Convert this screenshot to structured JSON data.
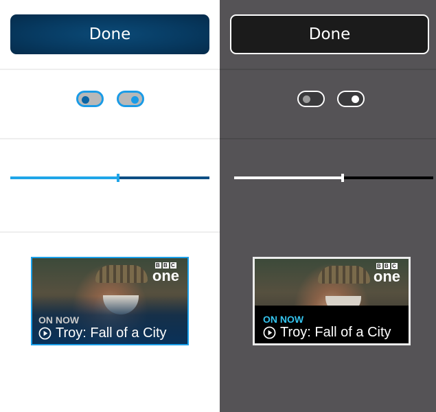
{
  "done_button": {
    "label": "Done"
  },
  "card": {
    "badge": "ON NOW",
    "title": "Troy: Fall of a City",
    "channel_logo": {
      "top": "BBC",
      "bottom": "one"
    }
  },
  "slider": {
    "value_percent": 54
  },
  "toggles": [
    {
      "state": "off"
    },
    {
      "state": "on"
    }
  ],
  "colors": {
    "accent_light": "#1aa0ea",
    "button_light": "#073a61",
    "dark_panel_bg": "#555356",
    "on_now_dark": "#34c4ee"
  }
}
